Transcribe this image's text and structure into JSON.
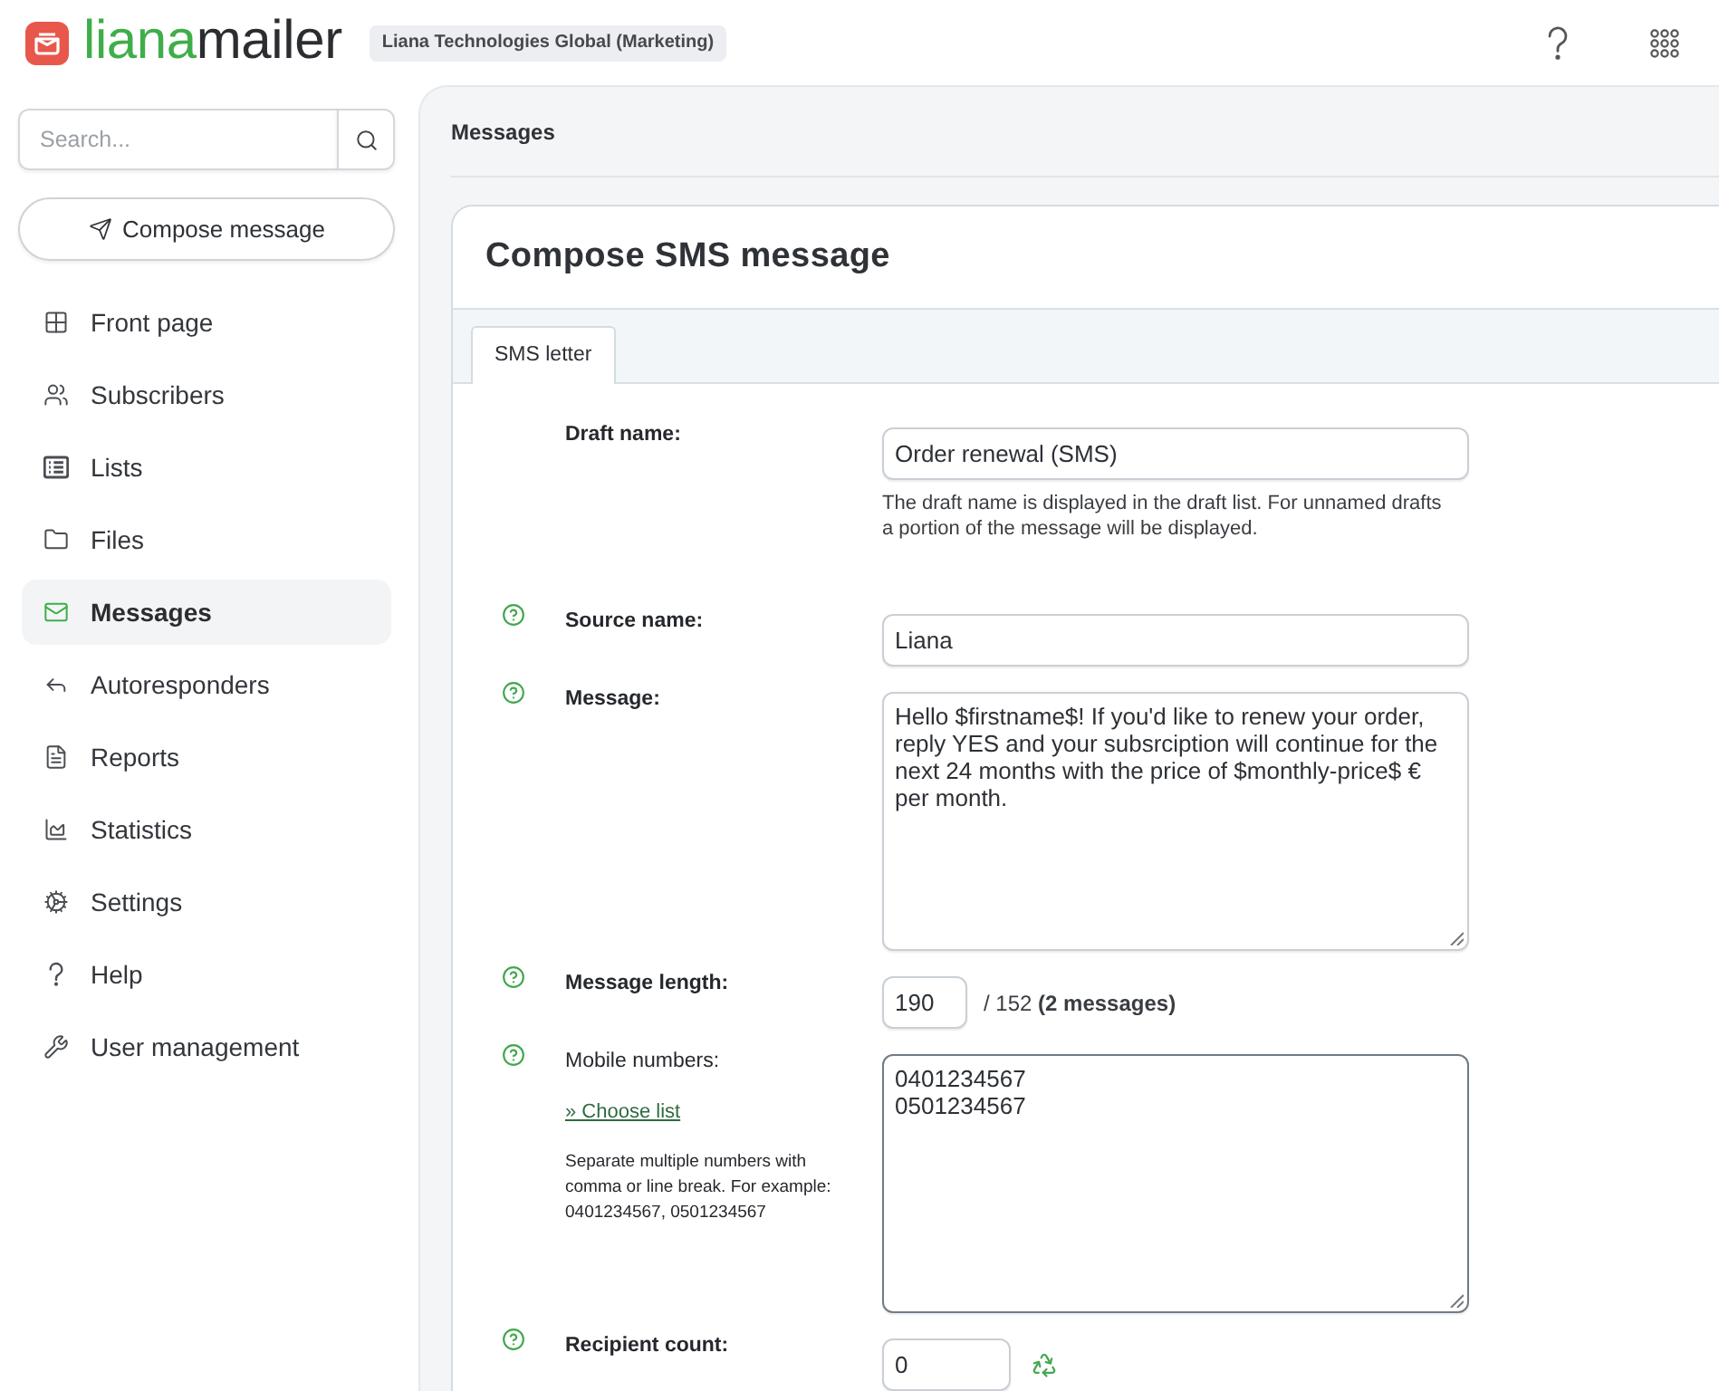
{
  "header": {
    "logo": {
      "text_start": "liana",
      "text_end": "mailer"
    },
    "organization": "Liana Technologies Global (Marketing)"
  },
  "sidebar": {
    "search": {
      "placeholder": "Search..."
    },
    "compose_button": "Compose message",
    "items": [
      {
        "label": "Front page",
        "selected": false
      },
      {
        "label": "Subscribers",
        "selected": false
      },
      {
        "label": "Lists",
        "selected": false
      },
      {
        "label": "Files",
        "selected": false
      },
      {
        "label": "Messages",
        "selected": true
      },
      {
        "label": "Autoresponders",
        "selected": false
      },
      {
        "label": "Reports",
        "selected": false
      },
      {
        "label": "Statistics",
        "selected": false
      },
      {
        "label": "Settings",
        "selected": false
      },
      {
        "label": "Help",
        "selected": false
      },
      {
        "label": "User management",
        "selected": false
      }
    ]
  },
  "main": {
    "breadcrumb": "Messages",
    "title": "Compose SMS message",
    "tabs": [
      {
        "label": "SMS letter",
        "selected": true
      }
    ],
    "form": [
      {
        "kind": "text",
        "label": "Draft name:",
        "help": false,
        "focused": false,
        "value": "Order renewal (SMS)",
        "hint": "The draft name is displayed in the draft list. For unnamed drafts a portion of the message will be displayed."
      },
      {
        "kind": "text",
        "label": "Source name:",
        "help": true,
        "focused": false,
        "value": "Liana"
      },
      {
        "kind": "textarea",
        "label": "Message:",
        "help": true,
        "focused": false,
        "value": "Hello $firstname$! If you'd like to renew your order, reply YES and your subsrciption will continue for the next 24 months with the price of $monthly-price$ € per month."
      },
      {
        "kind": "length",
        "label": "Message length:",
        "help": true,
        "focused": false,
        "value": "190",
        "counter": "/ 152 **(2 messages)**"
      },
      {
        "kind": "numbers",
        "label": "Mobile numbers:",
        "help": true,
        "focused": true,
        "link": "» Choose list",
        "note": "Separate multiple numbers with comma or line break. For example: 0401234567, 0501234567",
        "value": "0401234567\n0501234567"
      },
      {
        "kind": "count",
        "label": "Recipient count:",
        "help": true,
        "focused": false,
        "value": "0"
      }
    ]
  }
}
